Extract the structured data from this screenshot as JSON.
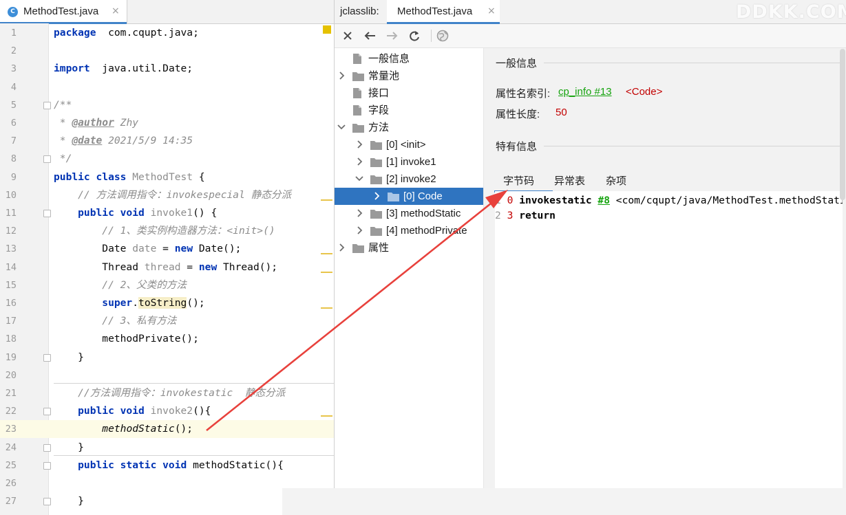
{
  "editor": {
    "tab": {
      "icon": "C",
      "filename": "MethodTest.java",
      "close": "×"
    },
    "lines": [
      {
        "n": "1",
        "segs": [
          [
            "kw",
            "package"
          ],
          [
            "",
            "  com.cqupt.java;"
          ]
        ]
      },
      {
        "n": "2",
        "segs": []
      },
      {
        "n": "3",
        "segs": [
          [
            "kw",
            "import"
          ],
          [
            "",
            "  java.util.Date;"
          ]
        ]
      },
      {
        "n": "4",
        "segs": []
      },
      {
        "n": "5",
        "segs": [
          [
            "cm-doc",
            "/**"
          ]
        ]
      },
      {
        "n": "6",
        "segs": [
          [
            "cm-doc",
            " * "
          ],
          [
            "tag",
            "@author"
          ],
          [
            "cm-doc",
            " Zhy"
          ]
        ]
      },
      {
        "n": "7",
        "segs": [
          [
            "cm-doc",
            " * "
          ],
          [
            "tag",
            "@date"
          ],
          [
            "cm-doc",
            " 2021/5/9 14:35"
          ]
        ]
      },
      {
        "n": "8",
        "segs": [
          [
            "cm-doc",
            " */"
          ]
        ]
      },
      {
        "n": "9",
        "segs": [
          [
            "kw",
            "public class "
          ],
          [
            "unused",
            "MethodTest"
          ],
          [
            "",
            " {"
          ]
        ]
      },
      {
        "n": "10",
        "segs": [
          [
            "cm",
            "    // 方法调用指令：invokespecial 静态分派"
          ]
        ]
      },
      {
        "n": "11",
        "segs": [
          [
            "kw",
            "    public void "
          ],
          [
            "unused",
            "invoke1"
          ],
          [
            "",
            "() {"
          ]
        ]
      },
      {
        "n": "12",
        "segs": [
          [
            "cm",
            "        // 1、类实例构造器方法：<init>()"
          ]
        ]
      },
      {
        "n": "13",
        "segs": [
          [
            "",
            "        Date "
          ],
          [
            "unused",
            "date"
          ],
          [
            "",
            " = "
          ],
          [
            "kw",
            "new"
          ],
          [
            "",
            " Date();"
          ]
        ]
      },
      {
        "n": "14",
        "segs": [
          [
            "",
            "        Thread "
          ],
          [
            "unused",
            "thread"
          ],
          [
            "",
            " = "
          ],
          [
            "kw",
            "new"
          ],
          [
            "",
            " Thread();"
          ]
        ]
      },
      {
        "n": "15",
        "segs": [
          [
            "cm",
            "        // 2、父类的方法"
          ]
        ]
      },
      {
        "n": "16",
        "segs": [
          [
            "kw",
            "        super"
          ],
          [
            "",
            "."
          ],
          [
            "hl",
            "toString"
          ],
          [
            "",
            "();"
          ]
        ]
      },
      {
        "n": "17",
        "segs": [
          [
            "cm",
            "        // 3、私有方法"
          ]
        ]
      },
      {
        "n": "18",
        "segs": [
          [
            "",
            "        methodPrivate();"
          ]
        ]
      },
      {
        "n": "19",
        "segs": [
          [
            "",
            "    }"
          ]
        ]
      },
      {
        "n": "20",
        "segs": []
      },
      {
        "n": "21",
        "segs": [
          [
            "cm",
            "    //方法调用指令：invokestatic  静态分派"
          ]
        ]
      },
      {
        "n": "22",
        "segs": [
          [
            "kw",
            "    public void "
          ],
          [
            "unused",
            "invoke2"
          ],
          [
            "",
            "(){"
          ]
        ]
      },
      {
        "n": "23",
        "segs": [
          [
            "",
            "        "
          ],
          [
            "static-call",
            "methodStatic"
          ],
          [
            "",
            "();"
          ]
        ]
      },
      {
        "n": "24",
        "segs": [
          [
            "",
            "    }"
          ]
        ]
      },
      {
        "n": "25",
        "segs": [
          [
            "kw",
            "    public static void "
          ],
          [
            "",
            "methodStatic(){"
          ]
        ]
      },
      {
        "n": "26",
        "segs": []
      },
      {
        "n": "27",
        "segs": [
          [
            "",
            "    }"
          ]
        ]
      }
    ]
  },
  "jclasslib": {
    "prefix": "jclasslib:",
    "tab": {
      "filename": "MethodTest.java",
      "close": "×"
    },
    "watermark": "DDKK.COM",
    "toolbar": [
      "close-icon",
      "back-arrow-icon",
      "forward-arrow-icon",
      "refresh-icon",
      "web-globe-icon"
    ],
    "tree": [
      {
        "label": "一般信息",
        "level": 0,
        "arrow": "none",
        "icon": "file"
      },
      {
        "label": "常量池",
        "level": 0,
        "arrow": "right",
        "icon": "folder"
      },
      {
        "label": "接口",
        "level": 0,
        "arrow": "none",
        "icon": "file"
      },
      {
        "label": "字段",
        "level": 0,
        "arrow": "none",
        "icon": "file"
      },
      {
        "label": "方法",
        "level": 0,
        "arrow": "down",
        "icon": "folder"
      },
      {
        "label": "[0] <init>",
        "level": 1,
        "arrow": "right",
        "icon": "folder"
      },
      {
        "label": "[1] invoke1",
        "level": 1,
        "arrow": "right",
        "icon": "folder"
      },
      {
        "label": "[2] invoke2",
        "level": 1,
        "arrow": "down",
        "icon": "folder"
      },
      {
        "label": "[0] Code",
        "level": 2,
        "arrow": "right",
        "icon": "folder",
        "selected": true
      },
      {
        "label": "[3] methodStatic",
        "level": 1,
        "arrow": "right",
        "icon": "folder"
      },
      {
        "label": "[4] methodPrivate",
        "level": 1,
        "arrow": "right",
        "icon": "folder"
      },
      {
        "label": "属性",
        "level": 0,
        "arrow": "right",
        "icon": "folder"
      }
    ],
    "details": {
      "general_title": "一般信息",
      "attr_name_label": "属性名索引:",
      "attr_name_link": "cp_info #13",
      "attr_name_value": "<Code>",
      "attr_len_label": "属性长度:",
      "attr_len_value": "50",
      "specific_title": "特有信息",
      "subtabs": [
        "字节码",
        "异常表",
        "杂项"
      ],
      "bytecode": [
        {
          "ln": "1",
          "off": "0",
          "op": "invokestatic",
          "ref": "#8",
          "comment": "<com/cqupt/java/MethodTest.methodStatic>"
        },
        {
          "ln": "2",
          "off": "3",
          "op": "return",
          "ref": "",
          "comment": ""
        }
      ]
    }
  },
  "colors": {
    "accent": "#4083c9",
    "selection": "#2f74c0",
    "keyword": "#0033b3",
    "comment": "#8c8c8c",
    "link": "#16a30f",
    "value_red": "#c20000",
    "annotation_arrow": "#e8413c"
  }
}
